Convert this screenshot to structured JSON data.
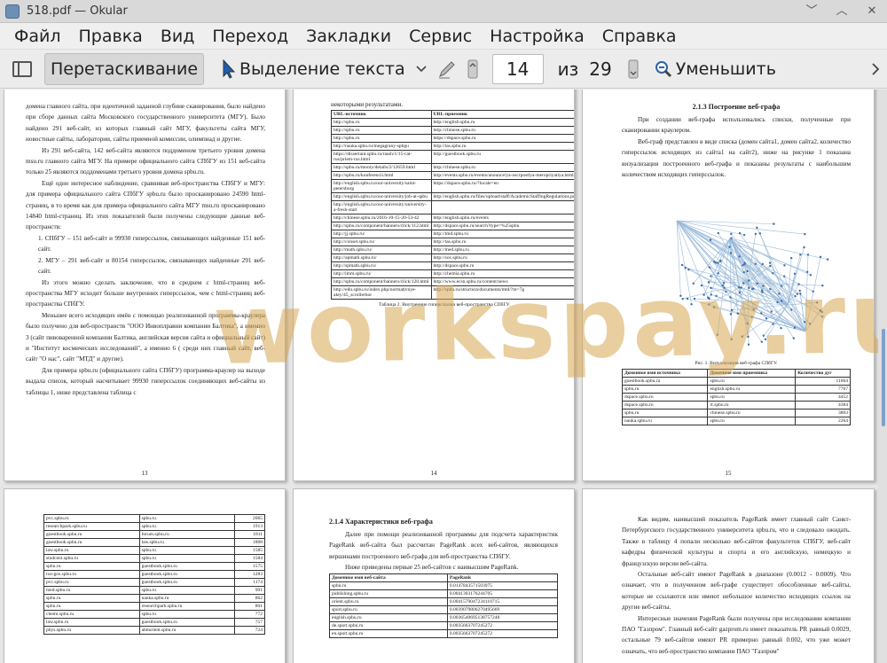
{
  "window": {
    "title": "518.pdf — Okular",
    "btn_minimize": "﹀",
    "btn_maximize": "︿",
    "btn_close": "✕"
  },
  "menu": [
    "Файл",
    "Правка",
    "Вид",
    "Переход",
    "Закладки",
    "Сервис",
    "Настройка",
    "Справка"
  ],
  "toolbar": {
    "drag_label": "Перетаскивание",
    "select_label": "Выделение текста",
    "page_current": "14",
    "of_label": "из",
    "page_total": "29",
    "zoom_out_label": "Уменьшить"
  },
  "watermark": "workspay.ru",
  "page13": {
    "paras": [
      "домена главного сайта, при идентичной заданной глубине сканирования, было найдено при сборе данных сайта Московского государственного университета (МГУ). Было найдено 291 веб-сайт, из которых главный сайт МГУ, факультеты сайта МГУ, новостные сайты, лаборатории, сайты приемной комиссии, олимпиад и другие.",
      "Из 291 веб-сайта, 142 веб-сайта являются поддоменом третьего уровня домена msu.ru главного сайта МГУ. На примере официального сайта СПбГУ из 151 веб-сайта только 25 являются поддоменами третьего уровня домена spbu.ru.",
      "Ещё одно интересное наблюдение, сравнивая веб-пространства СПбГУ и МГУ: для примера официального сайта СПбГУ spbu.ru было просканировано 24590 html-страниц, в то время как для примера официального сайта МГУ msu.ru просканировано 14840 html-страниц. Из этих показателей были получены следующие данные веб-пространств:",
      "1. СПбГУ – 151 веб-сайт и 99930 гиперссылок, связывающих найденные 151 веб-сайт.",
      "2. МГУ – 291 веб-сайт и 80154 гиперссылок, связывающих найденные 291 веб-сайт.",
      "Из этого можно сделать заключение, что в среднем с html-страниц веб-пространства МГУ исходит больше внутренних гиперссылок, чем с html-страниц веб-пространства СПбГУ.",
      "Меньшее всего исходящих имён с помощью реализованной программы-краулера было получено для веб-пространств \"ООО Инвоплравни компании Балтика\", а именно 3 (сайт пивоваренной компании Балтика, английская версия сайта и официальный сайт) и \"Институт космических исследований\", а именно 6 ( среди них главный сайт, веб-сайт \"О нас\", сайт \"МТД\" и другие).",
      "Для примера spbu.ru (официального сайта СПбГУ) программа-краулер на выходе выдала список, который насчитывает 99930 гиперссылок соединяющих веб-сайты из таблицы 1, ниже представлена таблица с"
    ],
    "num": "13"
  },
  "page14": {
    "intro": "некоторыми результатами.",
    "head": [
      "URL-источник",
      "URL-приемник"
    ],
    "rows": [
      [
        "http://spbu.ru",
        "http://english.spbu.ru"
      ],
      [
        "http://spbu.ru",
        "http://chinese.spbu.ru"
      ],
      [
        "http://spbu.ru",
        "https://dspace.spbu.ru"
      ],
      [
        "http://nauka.spbu.ru/megagrany-spbgu",
        "http://tas.spbu.ru"
      ],
      [
        "https://dissertant.spbu.ru/rassh/1/15-cat-rus/priem-rus.html",
        "http://guestbook.spbu.ru"
      ],
      [
        "http://spbu.ru/mooty/details/2/12659.html",
        "http://chinese.spbu.ru"
      ],
      [
        "http://spbu.ru/konferencii.html",
        "http://events.spbu.ru/events/anounce/ya-oscrpostlya-meropriyatiya.html"
      ],
      [
        "http://english.spbu.ru/our-university/saint-petersburg",
        "https://dspace.spbu.ru/?locale=en"
      ],
      [
        "http://english.spbu.ru/our-university/job-at-spbu",
        "http://english.spbu.ru/files/upload/staff/AcademicStaffingRegulations.pdf"
      ],
      [
        "http://english.spbu.ru/our-university/university-a-fresh-start",
        ""
      ],
      [
        "http://chinese.spbu.ru/2016-10-15-20-53-42",
        "http://english.spbu.ru/events"
      ],
      [
        "http://spbu.ru/component/banners/click/112.html",
        "http://dspace.spbu.ru/search?type=%25spbu"
      ],
      [
        "http://jj.spbu.ru/",
        "http://tmd.spbu.ru"
      ],
      [
        "http://conset.spbu.ru/",
        "http://tas.spbu.ru"
      ],
      [
        "http://math.spbu.ru/",
        "http://med.spbu.ru"
      ],
      [
        "http://apmath.spbu.ru/",
        "http://soc.spbu.ru"
      ],
      [
        "http://spmath.spbu.ru/",
        "http://dspace.spbu.ru"
      ],
      [
        "http://imm.spbu.ru/",
        "http://chemia.spbu.ru"
      ],
      [
        "http://spbu.ru/component/banners/click/120.html",
        "http://www.ecsn.spbu.ru/content/news"
      ],
      [
        "http://edu.spbu.ru/index.php/normativnye-akty/45_scrollerhor",
        "http://spbu.ru/structura/documents/mtd/?m=7g"
      ]
    ],
    "caption": "Таблица 2. Внутренние гиперссылки веб-пространства СПбГУ.",
    "num": "14"
  },
  "page15": {
    "heading": "2.1.3 Построение веб-графа",
    "paras": [
      "При создании веб-графа использовались списки, полученные при сканировании краулером.",
      "Веб-граф представлен в виде списка (домен сайта1, домен сайта2, количество гиперссылок исходящих из сайта1 на сайт2), ниже на рисунке 1 показана визуализация построенного веб-графа и показаны результаты с наибольшим количеством исходящих гиперссылок."
    ],
    "fig_caption": "Рис. 1. Визуализация веб-графа СПбГУ.",
    "head": [
      "Доменное имя источника",
      "Доменное имя приемника",
      "Количество дуг"
    ],
    "rows": [
      [
        "guestbook.spbu.ru",
        "spbu.ru",
        "11664"
      ],
      [
        "spbu.ru",
        "english.spbu.ru",
        "7767"
      ],
      [
        "dspace.spbu.ru",
        "spbu.ru",
        "4452"
      ],
      [
        "dspace.spbu.ru",
        "rt.spbu.ru",
        "4384"
      ],
      [
        "spbu.ru",
        "chinese.spbu.ru",
        "3803"
      ],
      [
        "nauka.spbu.ru",
        "spbu.ru",
        "2264"
      ]
    ],
    "num": "15"
  },
  "page16": {
    "rows": [
      [
        "pvc.spbu.ru",
        "spbu.ru",
        "2065"
      ],
      [
        "researchpark.spbu.ru",
        "spbu.ru",
        "1913"
      ],
      [
        "guestbook.spbu.ru",
        "forum.spbu.ru",
        "1811"
      ],
      [
        "guestbook.spbu.ru",
        "law.spbu.ru",
        "1808"
      ],
      [
        "law.spbu.ru",
        "spbu.ru",
        "1585"
      ],
      [
        "studcent.spbu.ru",
        "spbu.ru",
        "1584"
      ],
      [
        "spbu.ru",
        "guestbook.spbu.ru",
        "1575"
      ],
      [
        "rus-gos.spbu.ru",
        "guestbook.spbu.ru",
        "1283"
      ],
      [
        "pvc.spbu.ru",
        "guestbook.spbu.ru",
        "1174"
      ],
      [
        "med.spbu.ru",
        "spbu.ru",
        "991"
      ],
      [
        "spbu.ru",
        "nauka.spbu.ru",
        "862"
      ],
      [
        "spbu.ru",
        "researchpark.spbu.ru",
        "801"
      ],
      [
        "chemi.spbu.ru",
        "spbu.ru",
        "772"
      ],
      [
        "law.spbu.ru",
        "guestbook.spbu.ru",
        "757"
      ],
      [
        "phys.spbu.ru",
        "abiturient.spbu.ru",
        "724"
      ]
    ]
  },
  "page17": {
    "heading": "2.1.4 Характеристики веб-графа",
    "paras": [
      "Далее при помощи реализованной программы для подсчета характеристик PageRank веб-сайта был рассчитан PageRank всех веб-сайтов, являющихся вершинами построенного веб-графа для веб-пространства СПбГУ.",
      "Ниже приведены первые 25 веб-сайтов с наивысшим PageRank."
    ],
    "head": [
      "Доменное имя веб-сайта",
      "PageRank"
    ],
    "rows": [
      [
        "spbu.ru",
        "0.0147843571503975"
      ],
      [
        "publishing.spbu.ru",
        "0.0041303176244705"
      ],
      [
        "orient.spbu.ru",
        "0.0041579047234110715"
      ],
      [
        "sport.spbu.ru",
        "0.0039079806270495669"
      ],
      [
        "english.spbu.ru",
        "0.0036540695138757248"
      ],
      [
        "de.sport.spbu.ru",
        "0.0035663707245272"
      ],
      [
        "en.sport.spbu.ru",
        "0.0035663707245272"
      ]
    ]
  },
  "page18": {
    "paras": [
      "Как видим, наивысший показатель PageRank имеет главный сайт Санкт-Петербургского государственного университета spbu.ru, что и следовало ожидать. Также в таблицу 4 попали несколько веб-сайтов факультетов СПбГУ, веб-сайт кафедры физической культуры и спорта и его английскую, немецкую и французскую версии веб-сайта.",
      "Остальные веб-сайт имеют PageRank в диапазоне (0.0012 - 0.0009). Что означает, что в полученном веб-графе существует обособленные веб-сайты, которые не ссылаются или имеют небольшое количество исходящих ссылок на другие веб-сайты.",
      "Интересные значения PageRank были получены при исследовании компании ПАО \"Газпром\". Главный веб-сайт gazprom.ru имеет показатель PR равный 0.0029, остальные 79 веб-сайтов имеют PR примерно равный 0.002, что уже может означать, что веб-пространство компании ПАО \"Газпром\""
    ]
  }
}
